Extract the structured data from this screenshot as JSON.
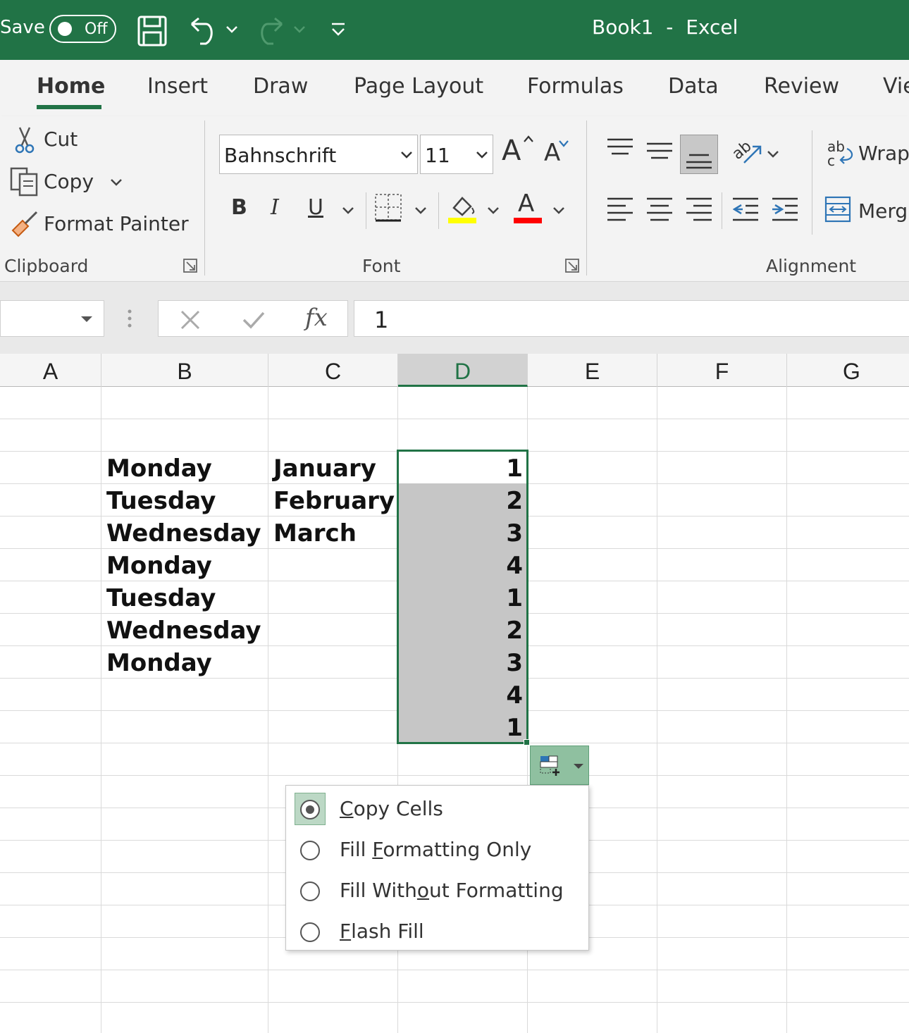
{
  "titlebar": {
    "autosave_label": "Save",
    "toggle_state": "Off",
    "doc_title": "Book1  -  Excel",
    "bg_color": "#217346"
  },
  "tabs": [
    "Home",
    "Insert",
    "Draw",
    "Page Layout",
    "Formulas",
    "Data",
    "Review",
    "Vie"
  ],
  "ribbon": {
    "clipboard": {
      "cut": "Cut",
      "copy": "Copy",
      "format_painter": "Format Painter",
      "group_label": "Clipboard"
    },
    "font": {
      "font_name": "Bahnschrift",
      "font_size": "11",
      "bold": "B",
      "italic": "I",
      "underline": "U",
      "font_color_glyph": "A",
      "grow_glyph": "A",
      "shrink_glyph": "A",
      "group_label": "Font",
      "highlight_color": "#ffff00",
      "font_color": "#ff0000"
    },
    "alignment": {
      "wrap": "Wrap",
      "merge": "Merg",
      "group_label": "Alignment"
    }
  },
  "formula_bar": {
    "value": "1",
    "fx": "fx"
  },
  "columns": [
    "A",
    "B",
    "C",
    "D",
    "E",
    "F",
    "G"
  ],
  "selected_column": "D",
  "cells": {
    "B": [
      "Monday",
      "Tuesday",
      "Wednesday",
      "Monday",
      "Tuesday",
      "Wednesday",
      "Monday"
    ],
    "C": [
      "January",
      "February",
      "March"
    ],
    "D": [
      "1",
      "2",
      "3",
      "4",
      "1",
      "2",
      "3",
      "4",
      "1"
    ]
  },
  "autofill_menu": {
    "items": [
      {
        "pre": "",
        "key": "C",
        "post": "opy Cells",
        "selected": true
      },
      {
        "pre": "Fill ",
        "key": "F",
        "post": "ormatting Only",
        "selected": false
      },
      {
        "pre": "Fill With",
        "key": "o",
        "post": "ut Formatting",
        "selected": false
      },
      {
        "pre": "",
        "key": "F",
        "post": "lash Fill",
        "selected": false
      }
    ]
  }
}
